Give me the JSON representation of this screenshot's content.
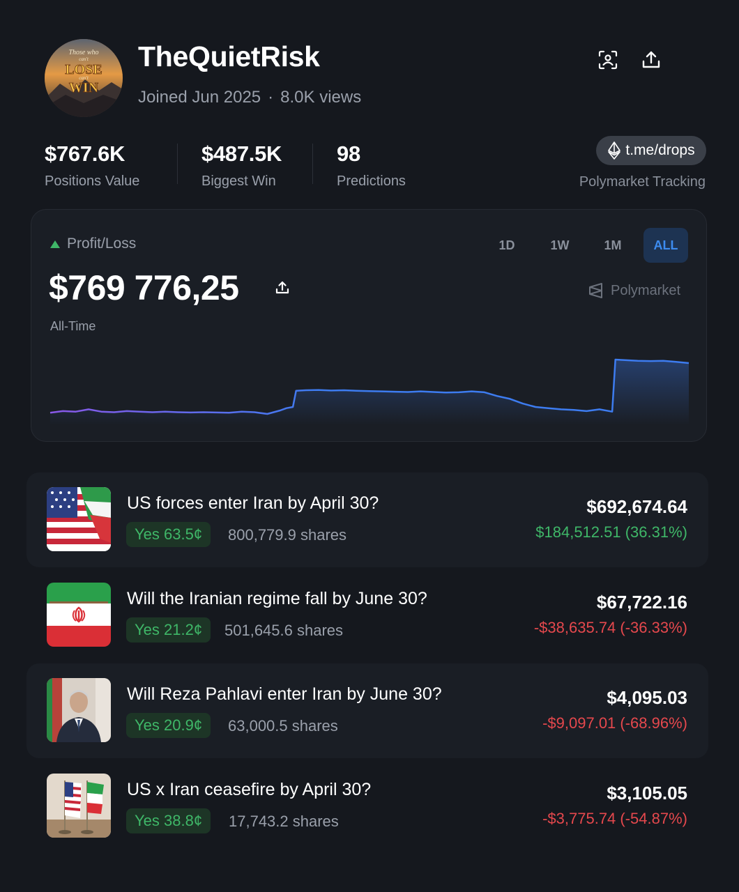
{
  "profile": {
    "username": "TheQuietRisk",
    "joined": "Joined Jun 2025",
    "separator": "·",
    "views": "8.0K views",
    "avatar_text": [
      "Those who",
      "can't",
      "LOSE",
      "can't",
      "WIN"
    ]
  },
  "stats": [
    {
      "value": "$767.6K",
      "label": "Positions Value"
    },
    {
      "value": "$487.5K",
      "label": "Biggest Win"
    },
    {
      "value": "98",
      "label": "Predictions"
    }
  ],
  "promo": {
    "link": "t.me/drops",
    "caption": "Polymarket Tracking"
  },
  "pnl": {
    "label": "Profit/Loss",
    "value": "$769 776,25",
    "period": "All-Time",
    "brand": "Polymarket",
    "ranges": [
      "1D",
      "1W",
      "1M",
      "ALL"
    ],
    "active_range": "ALL"
  },
  "chart_data": {
    "type": "area",
    "x": [
      0,
      2,
      4,
      6,
      8,
      10,
      12,
      14,
      16,
      18,
      20,
      22,
      24,
      26,
      28,
      30,
      32,
      34,
      36,
      37,
      38,
      38.5,
      40,
      42,
      44,
      46,
      48,
      50,
      52,
      54,
      56,
      58,
      60,
      62,
      64,
      66,
      68,
      70,
      72,
      74,
      76,
      78,
      80,
      82,
      84,
      86,
      88,
      88.5,
      90,
      92,
      94,
      96,
      98,
      100
    ],
    "values": [
      0,
      0.3,
      0.2,
      0.6,
      0.2,
      0.1,
      0.3,
      0.2,
      0.1,
      0.2,
      0.1,
      0.05,
      0.1,
      0.05,
      0,
      0.2,
      0.1,
      -0.2,
      0.4,
      0.8,
      1.0,
      3.8,
      3.9,
      3.95,
      3.85,
      3.9,
      3.8,
      3.75,
      3.7,
      3.65,
      3.6,
      3.7,
      3.6,
      3.5,
      3.55,
      3.7,
      3.55,
      2.9,
      2.4,
      1.6,
      1.0,
      0.8,
      0.6,
      0.5,
      0.3,
      0.6,
      0.2,
      9.2,
      9.1,
      9.0,
      8.95,
      9.0,
      8.8,
      8.6
    ],
    "line_colors": [
      "#8a58e8",
      "#3d7cf0"
    ],
    "grid": false
  },
  "positions": [
    {
      "title": "US forces enter Iran by April 30?",
      "badge": "Yes 63.5¢",
      "shares": "800,779.9 shares",
      "value": "$692,674.64",
      "pnl": "$184,512.51 (36.31%)",
      "pnl_color": "#3fb768"
    },
    {
      "title": "Will the Iranian regime fall by June 30?",
      "badge": "Yes 21.2¢",
      "shares": "501,645.6 shares",
      "value": "$67,722.16",
      "pnl": "-$38,635.74 (-36.33%)",
      "pnl_color": "#e5484d"
    },
    {
      "title": "Will Reza Pahlavi enter Iran by June 30?",
      "badge": "Yes 20.9¢",
      "shares": "63,000.5 shares",
      "value": "$4,095.03",
      "pnl": "-$9,097.01 (-68.96%)",
      "pnl_color": "#e5484d"
    },
    {
      "title": "US x Iran ceasefire by April 30?",
      "badge": "Yes 38.8¢",
      "shares": "17,743.2 shares",
      "value": "$3,105.05",
      "pnl": "-$3,775.74 (-54.87%)",
      "pnl_color": "#e5484d"
    }
  ]
}
